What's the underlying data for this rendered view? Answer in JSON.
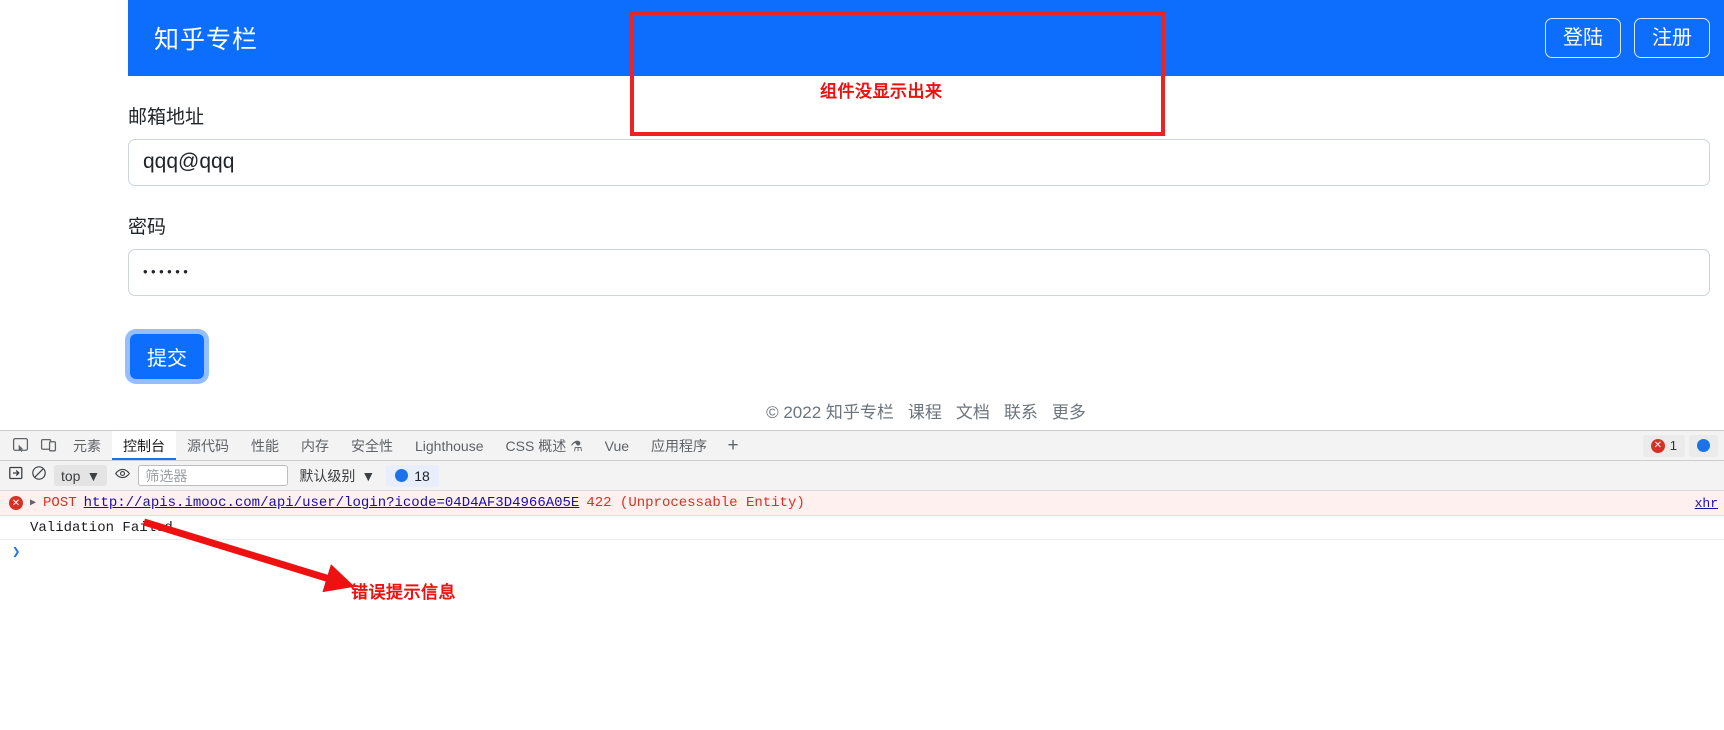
{
  "page": {
    "navbar": {
      "brand": "知乎专栏",
      "login_label": "登陆",
      "register_label": "注册"
    },
    "form": {
      "email_label": "邮箱地址",
      "email_value": "qqq@qqq",
      "email_placeholder": "",
      "password_label": "密码",
      "password_value": "••••••",
      "password_placeholder": "",
      "submit_label": "提交"
    },
    "footer": {
      "copyright": "© 2022 知乎专栏",
      "links": [
        "课程",
        "文档",
        "联系",
        "更多"
      ]
    }
  },
  "annotations": {
    "top_note": "组件没显示出来",
    "bottom_note": "错误提示信息",
    "color": "#ee1111"
  },
  "devtools": {
    "tabs": [
      {
        "label": "元素",
        "active": false
      },
      {
        "label": "控制台",
        "active": true
      },
      {
        "label": "源代码",
        "active": false
      },
      {
        "label": "性能",
        "active": false
      },
      {
        "label": "内存",
        "active": false
      },
      {
        "label": "安全性",
        "active": false
      },
      {
        "label": "Lighthouse",
        "active": false
      },
      {
        "label": "CSS 概述 ⚗",
        "active": false
      },
      {
        "label": "Vue",
        "active": false
      },
      {
        "label": "应用程序",
        "active": false
      }
    ],
    "add_tab_label": "+",
    "error_count": "1",
    "warning_count": "",
    "console_toolbar": {
      "context": "top",
      "filter_placeholder": "筛选器",
      "level": "默认级别",
      "issues_count": "18"
    },
    "console": {
      "error_method": "POST",
      "error_url": "http://apis.imooc.com/api/user/login?icode=04D4AF3D4966A05E",
      "error_status": "422 (Unprocessable Entity)",
      "error_source": "xhr",
      "message": "Validation Failed",
      "prompt": "❯"
    }
  },
  "colors": {
    "brand_blue": "#0d6efd",
    "annotation_red": "#ee1111",
    "console_error": "#d93025",
    "link_blue": "#1a0dab"
  }
}
